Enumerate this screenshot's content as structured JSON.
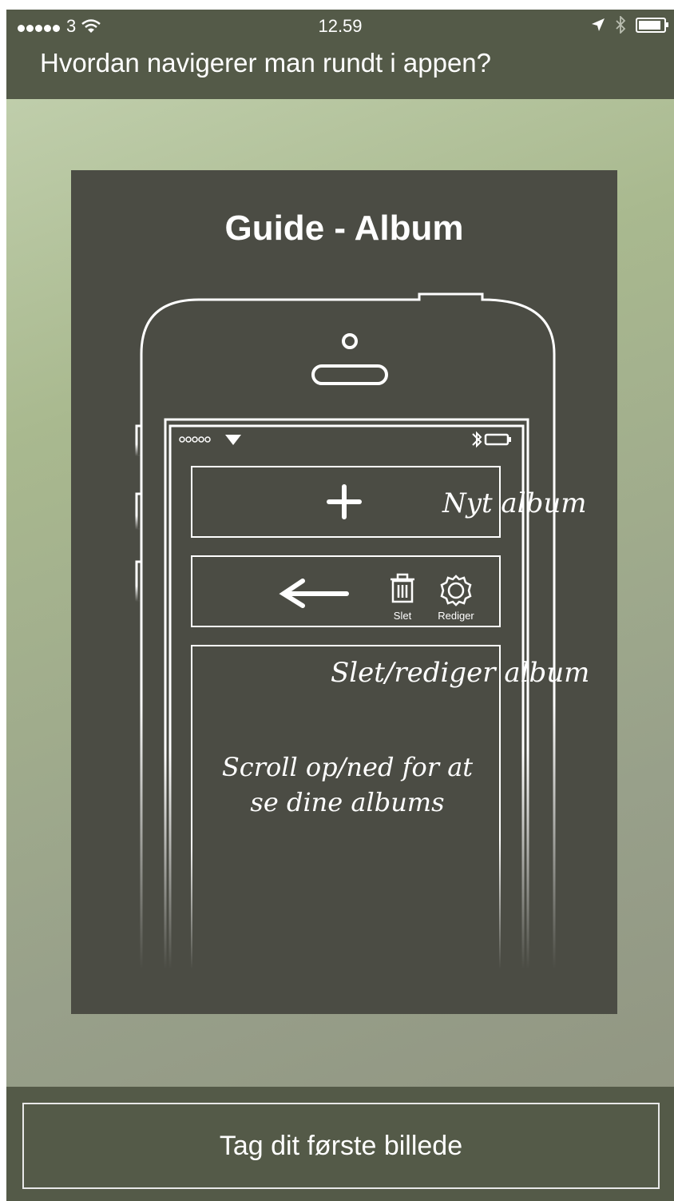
{
  "status_bar": {
    "carrier": "3",
    "time": "12.59"
  },
  "nav": {
    "title": "Hvordan navigerer man rundt i appen?"
  },
  "guide": {
    "title": "Guide - Album",
    "annotations": {
      "new_album": "Nyt album",
      "edit_delete_album": "Slet/rediger album",
      "scroll_line1": "Scroll op/ned for at",
      "scroll_line2": "se dine albums"
    },
    "mock_buttons": {
      "delete_label": "Slet",
      "edit_label": "Rediger"
    }
  },
  "cta": {
    "label": "Tag dit første billede"
  },
  "icons": [
    "signal-dots-icon",
    "wifi-icon",
    "location-arrow-icon",
    "bluetooth-icon",
    "battery-icon",
    "plus-icon",
    "arrow-left-icon",
    "trash-icon",
    "gear-icon"
  ]
}
